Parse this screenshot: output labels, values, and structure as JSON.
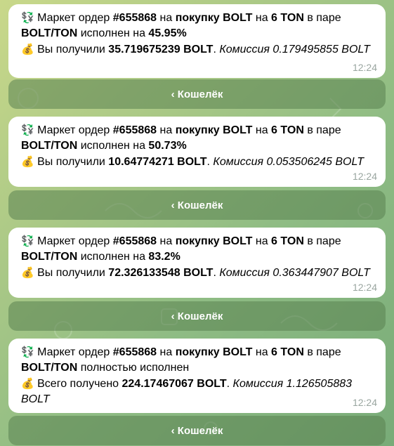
{
  "messages": [
    {
      "prefix": "Маркет ордер ",
      "order_id": "#655868",
      "on": " на ",
      "buy": "покупку BOLT",
      "on2": " на ",
      "amount": "6 TON",
      "pair_text": " в паре",
      "pair": "BOLT/TON",
      "status_prefix": " исполнен на ",
      "status_value": "45.95%",
      "received_prefix": " Вы получили ",
      "received_value": "35.719675239 BOLT",
      "received_suffix": ". ",
      "commission": "Комиссия 0.179495855 BOLT",
      "time": "12:24"
    },
    {
      "prefix": "Маркет ордер ",
      "order_id": "#655868",
      "on": " на ",
      "buy": "покупку BOLT",
      "on2": " на ",
      "amount": "6 TON",
      "pair_text": " в паре",
      "pair": "BOLT/TON",
      "status_prefix": " исполнен на ",
      "status_value": "50.73%",
      "received_prefix": " Вы получили ",
      "received_value": "10.64774271 BOLT",
      "received_suffix": ". ",
      "commission": "Комиссия 0.053506245 BOLT",
      "time": "12:24"
    },
    {
      "prefix": "Маркет ордер ",
      "order_id": "#655868",
      "on": " на ",
      "buy": "покупку BOLT",
      "on2": " на ",
      "amount": "6 TON",
      "pair_text": " в паре",
      "pair": "BOLT/TON",
      "status_prefix": " исполнен на ",
      "status_value": "83.2%",
      "received_prefix": " Вы получили ",
      "received_value": "72.326133548 BOLT",
      "received_suffix": ". ",
      "commission": "Комиссия 0.363447907 BOLT",
      "time": "12:24"
    },
    {
      "prefix": "Маркет ордер ",
      "order_id": "#655868",
      "on": " на ",
      "buy": "покупку BOLT",
      "on2": " на ",
      "amount": "6 TON",
      "pair_text": " в паре",
      "pair": "BOLT/TON",
      "status_prefix": " полностью исполнен",
      "status_value": "",
      "received_prefix": " Всего получено ",
      "received_value": "224.17467067 BOLT",
      "received_suffix": ". ",
      "commission": "Комиссия 1.126505883",
      "commission_line2": "BOLT",
      "time": "12:24"
    }
  ],
  "buttons": [
    {
      "label": "‹ Кошелёк"
    },
    {
      "label": "‹ Кошелёк"
    },
    {
      "label": "‹ Кошелёк"
    },
    {
      "label": "‹ Кошелёк"
    }
  ],
  "icons": {
    "exchange": "exchange-icon",
    "money_bag": "money-bag-icon"
  },
  "emoji": {
    "exchange": "💱",
    "money_bag": "💰"
  }
}
